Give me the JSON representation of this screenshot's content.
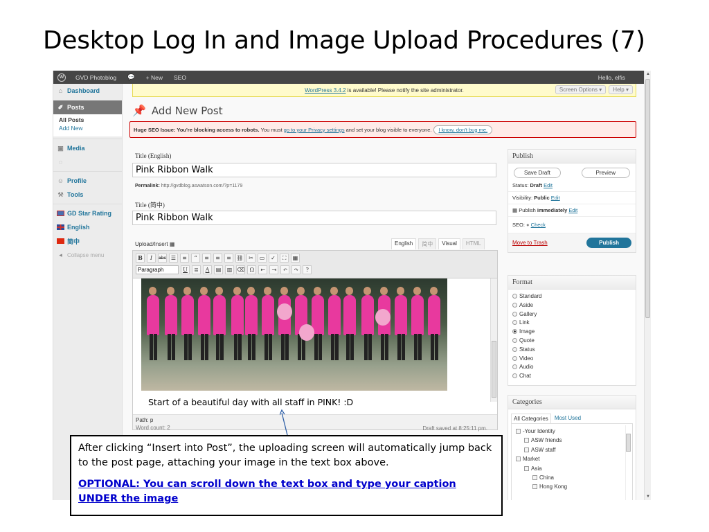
{
  "slide": {
    "title": "Desktop Log In and Image Upload Procedures (7)",
    "callout_text": "After clicking “Insert into Post”, the uploading screen will automatically jump back to the post page, attaching your image in the text box above.",
    "callout_optional": "OPTIONAL: You can scroll down the text box and type your caption UNDER the image"
  },
  "adminbar": {
    "site_name": "GVD Photoblog",
    "new_label": "+ New",
    "seo_label": "SEO",
    "greeting": "Hello, elfis"
  },
  "sidebar": {
    "dashboard": "Dashboard",
    "posts": "Posts",
    "all_posts": "All Posts",
    "add_new": "Add New",
    "media": "Media",
    "profile": "Profile",
    "tools": "Tools",
    "gd_star": "GD Star Rating",
    "english": "English",
    "chinese": "简中",
    "collapse": "Collapse menu"
  },
  "notices": {
    "update_link": "WordPress 3.4.2",
    "update_text": "is available! Please notify the site administrator.",
    "screen_options": "Screen Options ▾",
    "help": "Help ▾",
    "seo_bold": "Huge SEO Issue: You're blocking access to robots.",
    "seo_text1": "You must",
    "seo_link": "go to your Privacy settings",
    "seo_text2": "and set your blog visible to everyone.",
    "seo_dismiss": "I know, don't bug me."
  },
  "page": {
    "heading": "Add New Post",
    "title_en_label": "Title (English)",
    "title_en_value": "Pink Ribbon Walk",
    "permalink_label": "Permalink:",
    "permalink_url": "http://gvdblog.aswatson.com/?p=1179",
    "title_zh_label": "Title (简中)",
    "title_zh_value": "Pink Ribbon Walk",
    "upload_insert": "Upload/Insert"
  },
  "editor": {
    "tab_english": "English",
    "tab_chinese": "简中",
    "tab_visual": "Visual",
    "tab_html": "HTML",
    "format_select": "Paragraph",
    "caption": "Start of a beautiful day with all staff in PINK! :D",
    "path": "Path: p",
    "word_count": "Word count: 2",
    "draft_saved": "Draft saved at 8:25:11 pm."
  },
  "publish_box": {
    "heading": "Publish",
    "save_draft": "Save Draft",
    "preview": "Preview",
    "status_label": "Status:",
    "status_value": "Draft",
    "visibility_label": "Visibility:",
    "visibility_value": "Public",
    "publish_label": "Publish",
    "publish_value": "immediately",
    "edit": "Edit",
    "seo_label": "SEO:",
    "seo_check": "Check",
    "move_trash": "Move to Trash",
    "publish_button": "Publish"
  },
  "format_box": {
    "heading": "Format",
    "options": [
      "Standard",
      "Aside",
      "Gallery",
      "Link",
      "Image",
      "Quote",
      "Status",
      "Video",
      "Audio",
      "Chat"
    ],
    "selected": "Image"
  },
  "categories_box": {
    "heading": "Categories",
    "tab_all": "All Categories",
    "tab_used": "Most Used",
    "items": [
      {
        "label": "-Your Identity",
        "level": 0
      },
      {
        "label": "ASW friends",
        "level": 1
      },
      {
        "label": "ASW staff",
        "level": 1
      },
      {
        "label": "Market",
        "level": 0
      },
      {
        "label": "Asia",
        "level": 1
      },
      {
        "label": "China",
        "level": 2
      },
      {
        "label": "Hong Kong",
        "level": 2
      }
    ]
  },
  "colors": {
    "admin_bar": "#464646",
    "link_blue": "#21759b",
    "pink_shirts": "#e8399e",
    "callout_link": "#0000cc"
  }
}
